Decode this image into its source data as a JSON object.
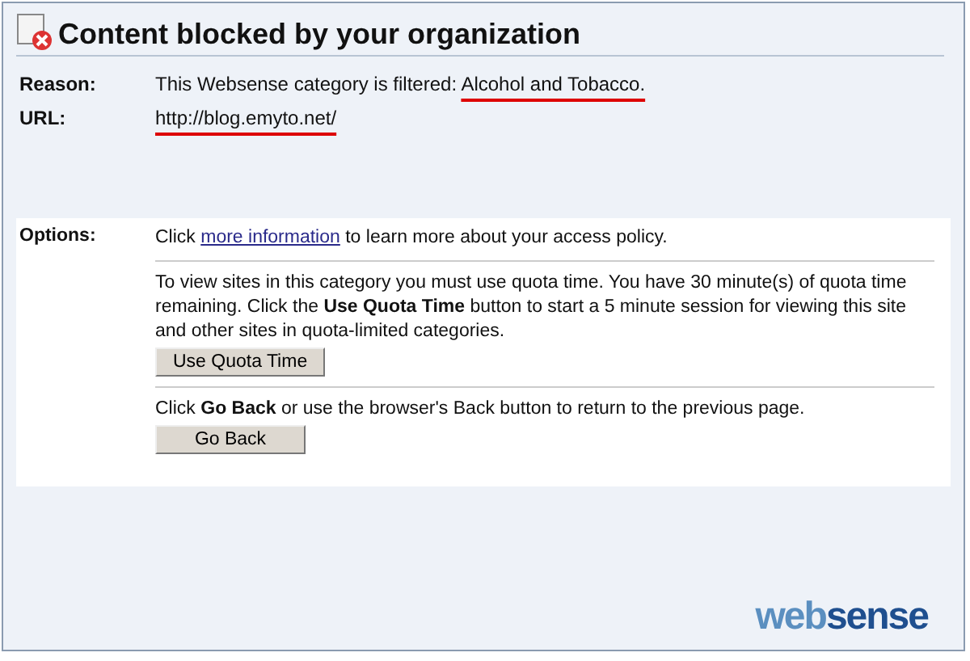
{
  "title": "Content blocked by your organization",
  "details": [
    {
      "label": "Reason:",
      "text": "This Websense category is filtered: ",
      "highlight": "Alcohol and Tobacco."
    },
    {
      "label": "URL:",
      "highlight": "http://blog.emyto.net/"
    }
  ],
  "options": {
    "label": "Options:",
    "info": {
      "before": "Click ",
      "link": "more information",
      "after": " to learn more about your access policy."
    },
    "quota": {
      "text": "To view sites in this category you must use quota time. You have 30 minute(s) of quota time remaining. Click the **Use Quota Time** button to start a 5 minute session for viewing this site and other sites in quota-limited categories.",
      "button": "Use Quota Time"
    },
    "back": {
      "text": "Click **Go Back** or use the browser's Back button to return to the previous page.",
      "button": "Go Back"
    }
  },
  "logo": {
    "part_1": "web",
    "part_2": "sense"
  }
}
